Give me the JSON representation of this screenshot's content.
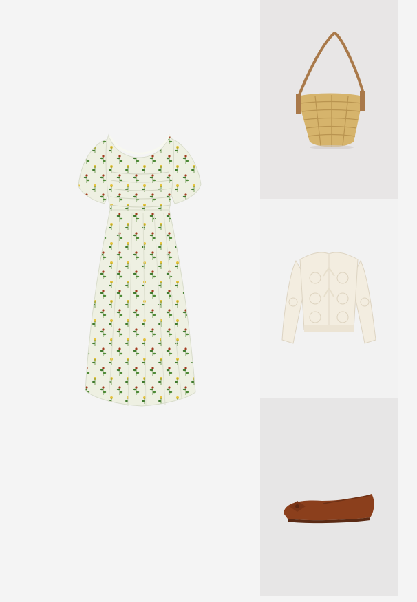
{
  "collage": {
    "items": [
      {
        "id": "dress",
        "icon": "floral-midi-dress-photo"
      },
      {
        "id": "bag",
        "icon": "straw-tote-bag-photo"
      },
      {
        "id": "cardigan",
        "icon": "crochet-cardigan-photo"
      },
      {
        "id": "shoe",
        "icon": "brown-suede-ballet-flat-photo"
      }
    ],
    "colors": {
      "page": "#f4f4f4",
      "tile_light": "#e8e6e6",
      "dress": "#eef0e2",
      "bag": "#d6b46c",
      "cardigan": "#f3ede0",
      "shoe": "#8b3f1c"
    }
  }
}
